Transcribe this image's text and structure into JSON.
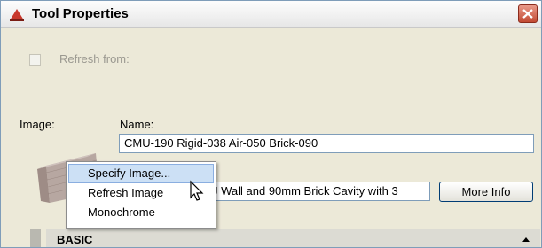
{
  "window": {
    "title": "Tool Properties",
    "accent_color": "#c8372b"
  },
  "refresh": {
    "label": "Refresh from:",
    "checked": false
  },
  "image": {
    "label": "Image:",
    "icon": "brick-wall-thumbnail"
  },
  "name": {
    "label": "Name:",
    "value": "CMU-190 Rigid-038 Air-050 Brick-090"
  },
  "description": {
    "value": "J Wall and 90mm Brick Cavity with 3"
  },
  "buttons": {
    "more_info": "More Info"
  },
  "context_menu": {
    "items": [
      {
        "label": "Specify Image...",
        "highlighted": true
      },
      {
        "label": "Refresh Image",
        "highlighted": false
      },
      {
        "label": "Monochrome",
        "highlighted": false
      }
    ]
  },
  "section": {
    "title": "BASIC",
    "state": "expanded"
  }
}
